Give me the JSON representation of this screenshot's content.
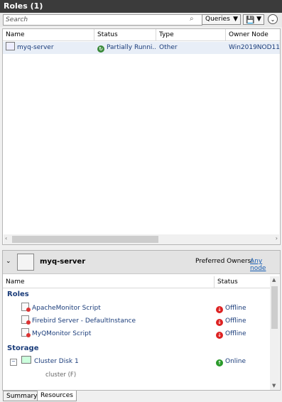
{
  "window": {
    "title": "Roles (1)"
  },
  "toolbar": {
    "search_placeholder": "Search",
    "queries_label": "Queries"
  },
  "roles_table": {
    "columns": [
      "Name",
      "Status",
      "Type",
      "Owner Node"
    ],
    "rows": [
      {
        "name": "myq-server",
        "status": "Partially Runni...",
        "type": "Other",
        "owner": "Win2019NOD11"
      }
    ]
  },
  "details": {
    "role_name": "myq-server",
    "preferred_owners_label": "Preferred Owners:",
    "preferred_owners_link": "Any node",
    "columns": [
      "Name",
      "Status"
    ],
    "groups": {
      "roles": "Roles",
      "storage": "Storage"
    },
    "resources": [
      {
        "name": "ApacheMonitor Script",
        "status": "Offline"
      },
      {
        "name": "Firebird Server - DefaultInstance",
        "status": "Offline"
      },
      {
        "name": "MyQMonitor Script",
        "status": "Offline"
      }
    ],
    "storage": {
      "name": "Cluster Disk 1",
      "status": "Online",
      "sub": "cluster (F)"
    }
  },
  "tabs": [
    "Summary",
    "Resources"
  ],
  "colors": {
    "titlebar": "#3b3b3b",
    "link": "#1a5fb4",
    "offline": "#d22222",
    "online": "#2a9a2a"
  }
}
